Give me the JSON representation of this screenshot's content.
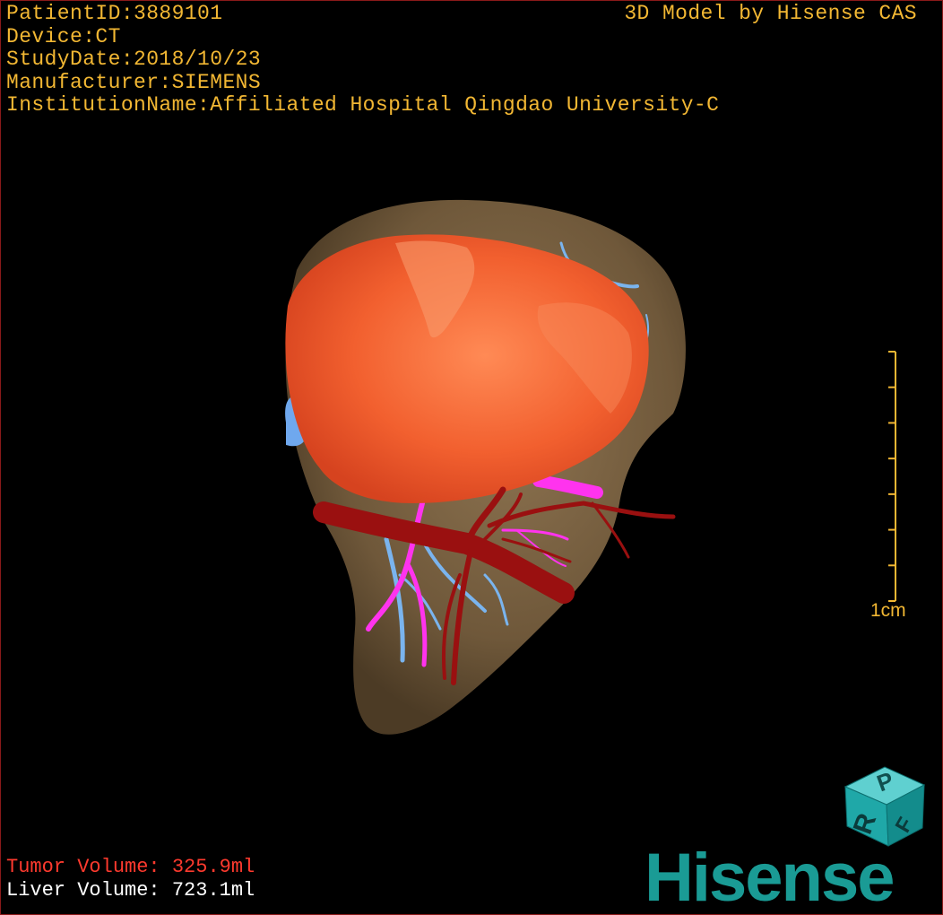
{
  "overlay": {
    "patient_id": "PatientID:3889101",
    "device": "Device:CT",
    "study_date": "StudyDate:2018/10/23",
    "manufacturer": "Manufacturer:SIEMENS",
    "institution": "InstitutionName:Affiliated Hospital Qingdao University-C",
    "credit": "3D Model by Hisense CAS"
  },
  "scale": {
    "label": "1cm",
    "ticks": 8
  },
  "volumes": {
    "tumor_label": "Tumor Volume:",
    "tumor_value": "325.9ml",
    "liver_label": "Liver Volume:",
    "liver_value": "723.1ml"
  },
  "orientation_cube": {
    "faces": [
      "P",
      "R",
      "F"
    ],
    "color": "#1fa8a8"
  },
  "brand": {
    "text": "Hisense",
    "color": "#1a9b95"
  },
  "colors": {
    "overlay_text": "#f2b733",
    "tumor_text": "#ff3a2e",
    "liver": "#7a6141",
    "tumor": "#f05a2e",
    "artery": "#9a1010",
    "portal_vein": "#ff33ee",
    "hepatic_vein": "#7ab4ee",
    "border": "#8a1a1a"
  }
}
